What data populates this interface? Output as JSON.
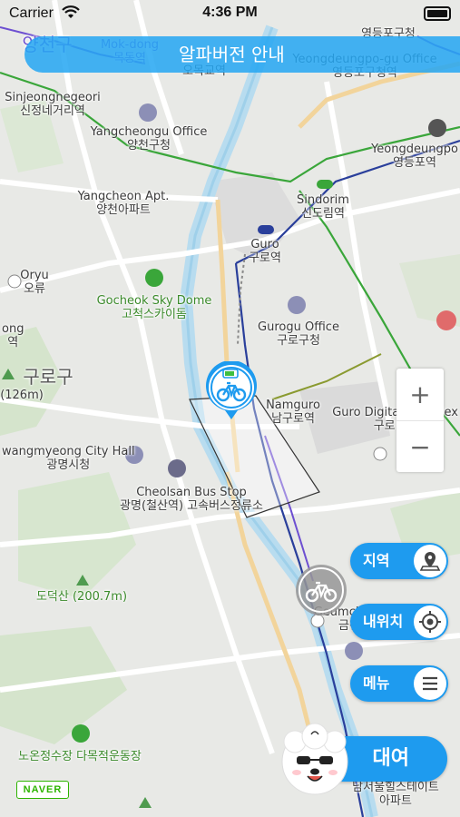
{
  "status_bar": {
    "carrier": "Carrier",
    "time": "4:36 PM"
  },
  "banner": {
    "text": "알파버전 안내"
  },
  "map": {
    "labels": [
      {
        "text": "양천구",
        "cls": "big sky"
      },
      {
        "text": "Mok-dong\n목동역",
        "cls": "sky"
      },
      {
        "text": "영등포구청",
        "cls": ""
      },
      {
        "text": "오목교역",
        "cls": ""
      },
      {
        "text": "Yeongdeungpo-gu Office\n영등포구청역",
        "cls": ""
      },
      {
        "text": "Sinjeongnegeori\n신정네거리역",
        "cls": ""
      },
      {
        "text": "Yangcheongu Office\n양천구청",
        "cls": ""
      },
      {
        "text": "Yeongdeungpo\n영등포역",
        "cls": ""
      },
      {
        "text": "Yangcheon Apt.\n양천아파트",
        "cls": ""
      },
      {
        "text": "Sindorim\n신도림역",
        "cls": ""
      },
      {
        "text": "Guro\n구로역",
        "cls": ""
      },
      {
        "text": "Oryu\n오류",
        "cls": ""
      },
      {
        "text": "Gocheok Sky Dome\n고척스카이돔",
        "cls": "green"
      },
      {
        "text": "Gurogu Office\n구로구청",
        "cls": ""
      },
      {
        "text": "ong\n역",
        "cls": ""
      },
      {
        "text": "구로구",
        "cls": "big"
      },
      {
        "text": "(126m)",
        "cls": ""
      },
      {
        "text": "Namguro\n남구로역",
        "cls": ""
      },
      {
        "text": "Guro Digital Complex\n구로디지",
        "cls": ""
      },
      {
        "text": "wangmyeong City Hall\n광명시청",
        "cls": ""
      },
      {
        "text": "Cheolsan Bus Stop\n광명(철산역) 고속버스정류소",
        "cls": ""
      },
      {
        "text": "도덕산 (200.7m)",
        "cls": "green"
      },
      {
        "text": "Geumcheon\n금천",
        "cls": ""
      },
      {
        "text": "노온정수장 다목적운동장",
        "cls": "green"
      },
      {
        "text": "남서울힐스테이트\n아파트",
        "cls": ""
      }
    ]
  },
  "zoom": {
    "in": "+",
    "out": "−"
  },
  "side_buttons": [
    {
      "label": "지역",
      "icon": "map-pin-icon"
    },
    {
      "label": "내위치",
      "icon": "locate-icon"
    },
    {
      "label": "메뉴",
      "icon": "menu-icon"
    }
  ],
  "rent_button": {
    "label": "대여"
  },
  "naver_logo": "NAVER",
  "colors": {
    "accent": "#1e9bef",
    "banner": "#25a7f2",
    "green_line": "#3aa63a",
    "blue_line": "#2a3f9b"
  }
}
